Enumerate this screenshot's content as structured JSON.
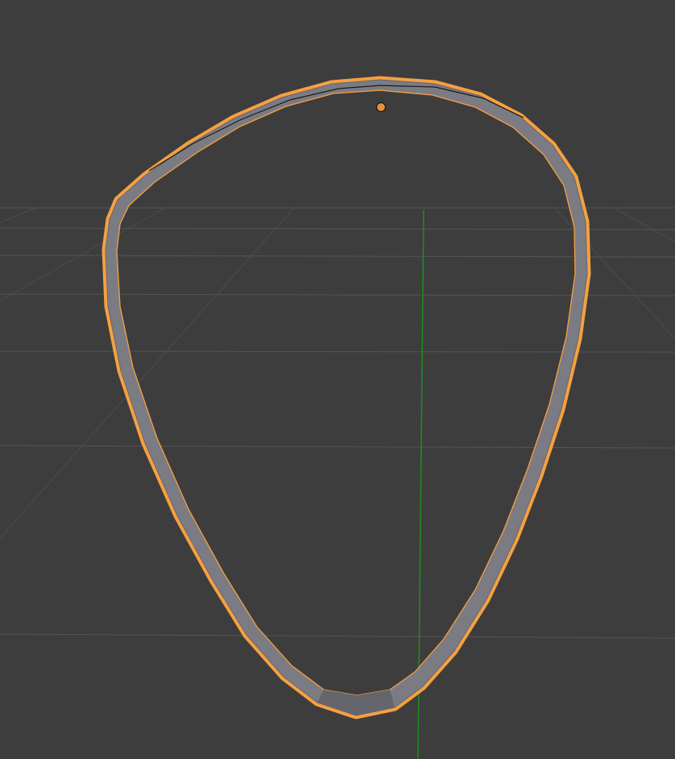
{
  "viewport": {
    "background_color": "#3d3d3d",
    "grid_color": "#555555",
    "y_axis_color": "#1e8a1e",
    "object_fill_color": "#7b7b84",
    "object_shade_color": "#65656d",
    "selection_outline_color": "#f5a040",
    "origin_color": "#e3913e",
    "object": {
      "name_icon": "guitar-pick-ring-mesh",
      "selected": true
    }
  }
}
